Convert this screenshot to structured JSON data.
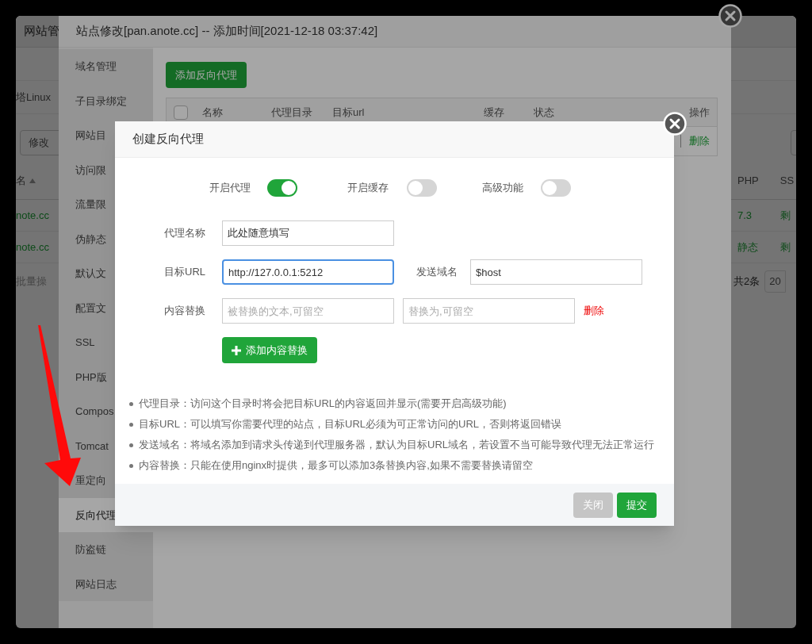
{
  "background_page": {
    "title": "网站管",
    "subtitle": "塔Linux",
    "edit_button": "修改",
    "name_column": "名",
    "right_columns": [
      "PHP",
      "SS"
    ],
    "rows": [
      {
        "site": "note.cc",
        "php": "7.3",
        "ssl": "剩"
      },
      {
        "site": "note.cc",
        "php": "静态",
        "ssl": "剩"
      }
    ],
    "batch_select": "批量操",
    "total": "共2条",
    "page_size": "20"
  },
  "site_dialog": {
    "title": "站点修改[pan.anote.cc] -- 添加时间[2021-12-18 03:37:42]",
    "menu": [
      {
        "label": "域名管理",
        "selected": false
      },
      {
        "label": "子目录绑定",
        "selected": false
      },
      {
        "label": "网站目",
        "selected": false
      },
      {
        "label": "访问限",
        "selected": false
      },
      {
        "label": "流量限",
        "selected": false
      },
      {
        "label": "伪静态",
        "selected": false
      },
      {
        "label": "默认文",
        "selected": false
      },
      {
        "label": "配置文",
        "selected": false
      },
      {
        "label": "SSL",
        "selected": false
      },
      {
        "label": "PHP版",
        "selected": false
      },
      {
        "label": "Compos",
        "selected": false
      },
      {
        "label": "Tomcat",
        "selected": false
      },
      {
        "label": "重定向",
        "selected": false
      },
      {
        "label": "反向代理",
        "selected": true
      },
      {
        "label": "防盗链",
        "selected": false
      },
      {
        "label": "网站日志",
        "selected": false
      }
    ],
    "add_button": "添加反向代理",
    "table": {
      "select_all_checked": false,
      "columns": [
        "名称",
        "代理目录",
        "目标url",
        "缓存",
        "状态",
        "操作"
      ],
      "row_action": "删除"
    }
  },
  "proxy_dialog": {
    "title": "创建反向代理",
    "toggles": [
      {
        "label": "开启代理",
        "on": true
      },
      {
        "label": "开启缓存",
        "on": false
      },
      {
        "label": "高级功能",
        "on": false
      }
    ],
    "rows": [
      {
        "items": [
          {
            "kind": "label",
            "text": "代理名称"
          },
          {
            "kind": "field",
            "value": "此处随意填写",
            "focused": false
          }
        ]
      },
      {
        "items": [
          {
            "kind": "label",
            "text": "目标URL"
          },
          {
            "kind": "field",
            "value": "http://127.0.0.1:5212",
            "focused": true
          },
          {
            "kind": "label",
            "text": "发送域名"
          },
          {
            "kind": "field",
            "value": "$host",
            "focused": false
          }
        ]
      },
      {
        "items": [
          {
            "kind": "label",
            "text": "内容替换"
          },
          {
            "kind": "field",
            "placeholder": "被替换的文本,可留空",
            "focused": false
          },
          {
            "kind": "field",
            "placeholder": "替换为,可留空",
            "focused": false
          },
          {
            "kind": "link",
            "text": "删除"
          }
        ]
      }
    ],
    "add_replace_button": "添加内容替换",
    "hints": [
      "代理目录：访问这个目录时将会把目标URL的内容返回并显示(需要开启高级功能)",
      "目标URL：可以填写你需要代理的站点，目标URL必须为可正常访问的URL，否则将返回错误",
      "发送域名：将域名添加到请求头传递到代理服务器，默认为目标URL域名，若设置不当可能导致代理无法正常运行",
      "内容替换：只能在使用nginx时提供，最多可以添加3条替换内容,如果不需要替换请留空"
    ],
    "buttons": [
      {
        "kind": "secondary",
        "label": "关闭"
      },
      {
        "kind": "primary",
        "label": "提交"
      }
    ]
  }
}
